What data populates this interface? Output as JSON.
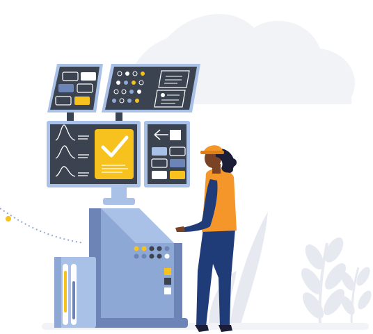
{
  "illustration": {
    "subject": "industrial-control-station",
    "colors": {
      "panel_dark": "#3b4350",
      "panel_frame": "#a9c1e6",
      "machine_light": "#8ea8d6",
      "machine_dark": "#6d84b6",
      "accent_yellow": "#f7c21e",
      "vest_orange": "#f5962a",
      "pants_navy": "#1f3c78",
      "skin": "#7a4326",
      "hair": "#1b1d36",
      "background_shape": "#f2f3f7",
      "plant": "#e7e9f1"
    },
    "icons": [
      "checkmark-icon",
      "waveform-icon",
      "back-arrow-icon",
      "document-icon",
      "hard-hat-icon"
    ]
  }
}
